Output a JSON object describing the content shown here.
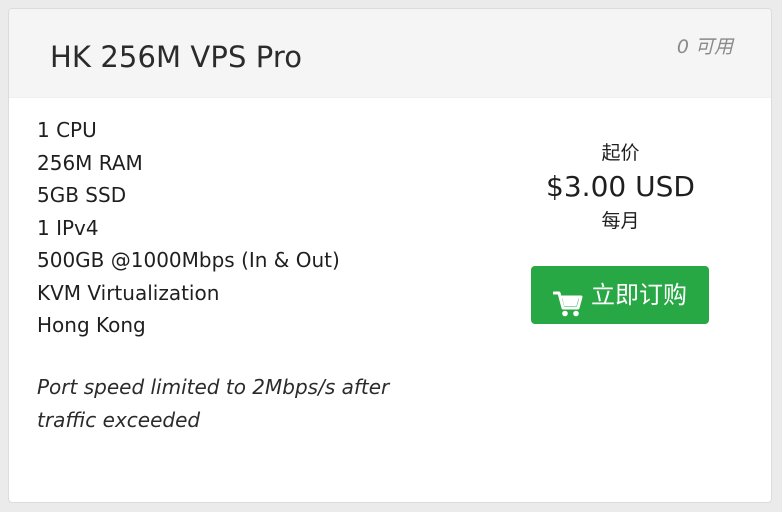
{
  "product": {
    "title": "HK 256M VPS Pro",
    "availability": "0 可用",
    "features": [
      "1 CPU",
      "256M RAM",
      "5GB SSD",
      "1 IPv4",
      "500GB @1000Mbps (In & Out)",
      "KVM Virtualization",
      "Hong Kong"
    ],
    "note": "Port speed limited to 2Mbps/s after traffic exceeded"
  },
  "pricing": {
    "from_label": "起价",
    "amount": "$3.00 USD",
    "cycle": "每月"
  },
  "order_button": {
    "icon": "shopping-cart-icon",
    "label": "立即订购",
    "color": "#28a745"
  }
}
